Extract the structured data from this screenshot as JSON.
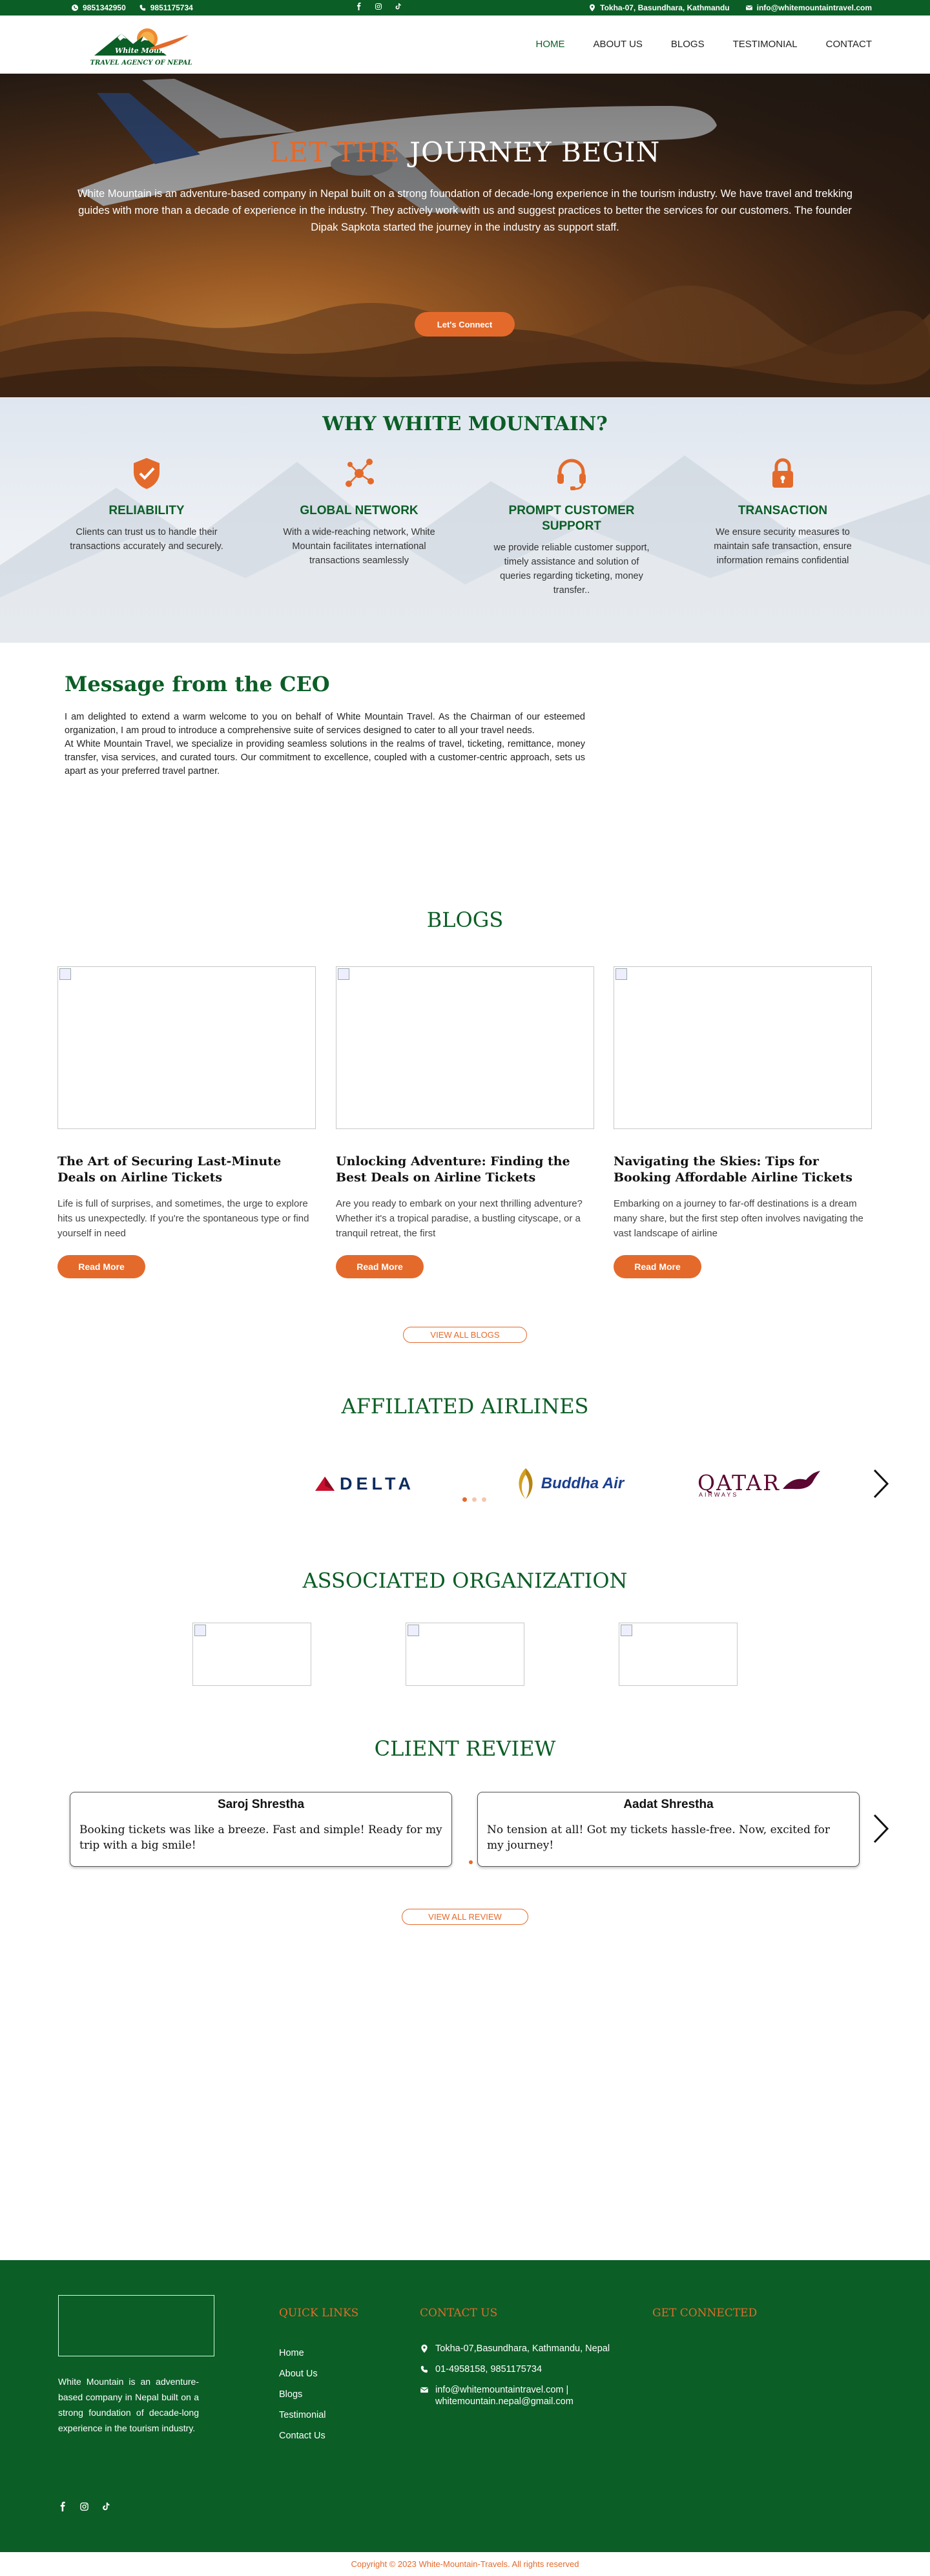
{
  "topbar": {
    "phone1": "9851342950",
    "phone2": "9851175734",
    "address": "Tokha-07, Basundhara, Kathmandu",
    "email": "info@whitemountaintravel.com"
  },
  "nav": {
    "logo_text": "TRAVEL AGENCY OF NEPAL",
    "items": [
      "HOME",
      "ABOUT US",
      "BLOGS",
      "TESTIMONIAL",
      "CONTACT"
    ]
  },
  "hero": {
    "title_accent": "LET THE",
    "title_rest": " JOURNEY BEGIN",
    "description": "White Mountain is an adventure-based company in Nepal built on a strong foundation of decade-long experience in the tourism industry. We have travel and trekking guides with more than a decade of experience in the industry. They actively work with us and suggest practices to better the services for our customers. The founder Dipak Sapkota started the journey in the industry as support staff.",
    "cta": "Let's Connect"
  },
  "why": {
    "title": "WHY WHITE MOUNTAIN?",
    "features": [
      {
        "icon": "shield-check-icon",
        "title": "RELIABILITY",
        "desc": "Clients can trust us to handle their transactions accurately and securely."
      },
      {
        "icon": "network-icon",
        "title": "GLOBAL NETWORK",
        "desc": "With a wide-reaching network, White Mountain facilitates international transactions seamlessly"
      },
      {
        "icon": "headset-icon",
        "title": "PROMPT CUSTOMER SUPPORT",
        "desc": "we provide reliable customer support,  timely assistance and solution of queries regarding ticketing, money transfer.."
      },
      {
        "icon": "lock-icon",
        "title": "TRANSACTION",
        "desc": "We ensure security measures to maintain safe transaction, ensure information remains confidential"
      }
    ]
  },
  "ceo": {
    "title": "Message from the CEO",
    "p1": "I am delighted to extend a warm welcome to you on behalf of White Mountain Travel. As the Chairman of our esteemed organization, I am proud to introduce a comprehensive suite of services designed to cater to all your travel needs.",
    "p2": "At White Mountain Travel, we specialize in providing seamless solutions in the realms of travel, ticketing, remittance, money transfer, visa services, and curated tours. Our commitment to excellence, coupled with a customer-centric approach, sets us apart as your preferred travel partner."
  },
  "blogs": {
    "title": "BLOGS",
    "read_more": "Read More",
    "view_all": "VIEW ALL BLOGS",
    "items": [
      {
        "title": "The Art of Securing Last-Minute Deals on Airline Tickets",
        "excerpt": "Life is full of surprises, and sometimes, the urge to explore hits us unexpectedly. If you're the spontaneous type or find yourself in need"
      },
      {
        "title": "Unlocking Adventure: Finding the Best Deals on Airline Tickets",
        "excerpt": "Are you ready to embark on your next thrilling adventure? Whether it's a tropical paradise, a bustling cityscape, or a tranquil retreat, the first"
      },
      {
        "title": "Navigating the Skies: Tips for Booking Affordable Airline Tickets",
        "excerpt": "Embarking on a journey to far-off destinations is a dream many share, but the first step often involves navigating the vast landscape of airline"
      }
    ]
  },
  "airlines": {
    "title": "AFFILIATED AIRLINES",
    "items": [
      "DELTA",
      "Buddha Air",
      "QATAR",
      "AIRWAYS"
    ]
  },
  "orgs": {
    "title": "ASSOCIATED ORGANIZATION"
  },
  "reviews": {
    "title": "CLIENT REVIEW",
    "view_all": "VIEW ALL REVIEW",
    "items": [
      {
        "name": "Saroj Shrestha",
        "text": "Booking tickets was like a breeze. Fast and simple! Ready for my trip with a big smile!"
      },
      {
        "name": "Aadat Shrestha",
        "text": "No tension at all! Got my tickets hassle-free. Now, excited for my journey!"
      }
    ]
  },
  "footer": {
    "about": "White Mountain is an adventure-based company in Nepal built on a strong foundation of decade-long experience in the tourism industry.",
    "quick_links_title": "QUICK LINKS",
    "quick_links": [
      "Home",
      "About Us",
      "Blogs",
      "Testimonial",
      "Contact Us"
    ],
    "contact_title": "CONTACT US",
    "address": "Tokha-07,Basundhara, Kathmandu, Nepal",
    "phones": "01-4958158, 9851175734",
    "emails": "info@whitemountaintravel.com | whitemountain.nepal@gmail.com",
    "connected_title": "GET CONNECTED",
    "copyright": "Copyright © 2023 White-Mountain-Travels. All rights reserved"
  },
  "colors": {
    "brand_green": "#0b5e26",
    "accent_orange": "#e46a2b"
  }
}
